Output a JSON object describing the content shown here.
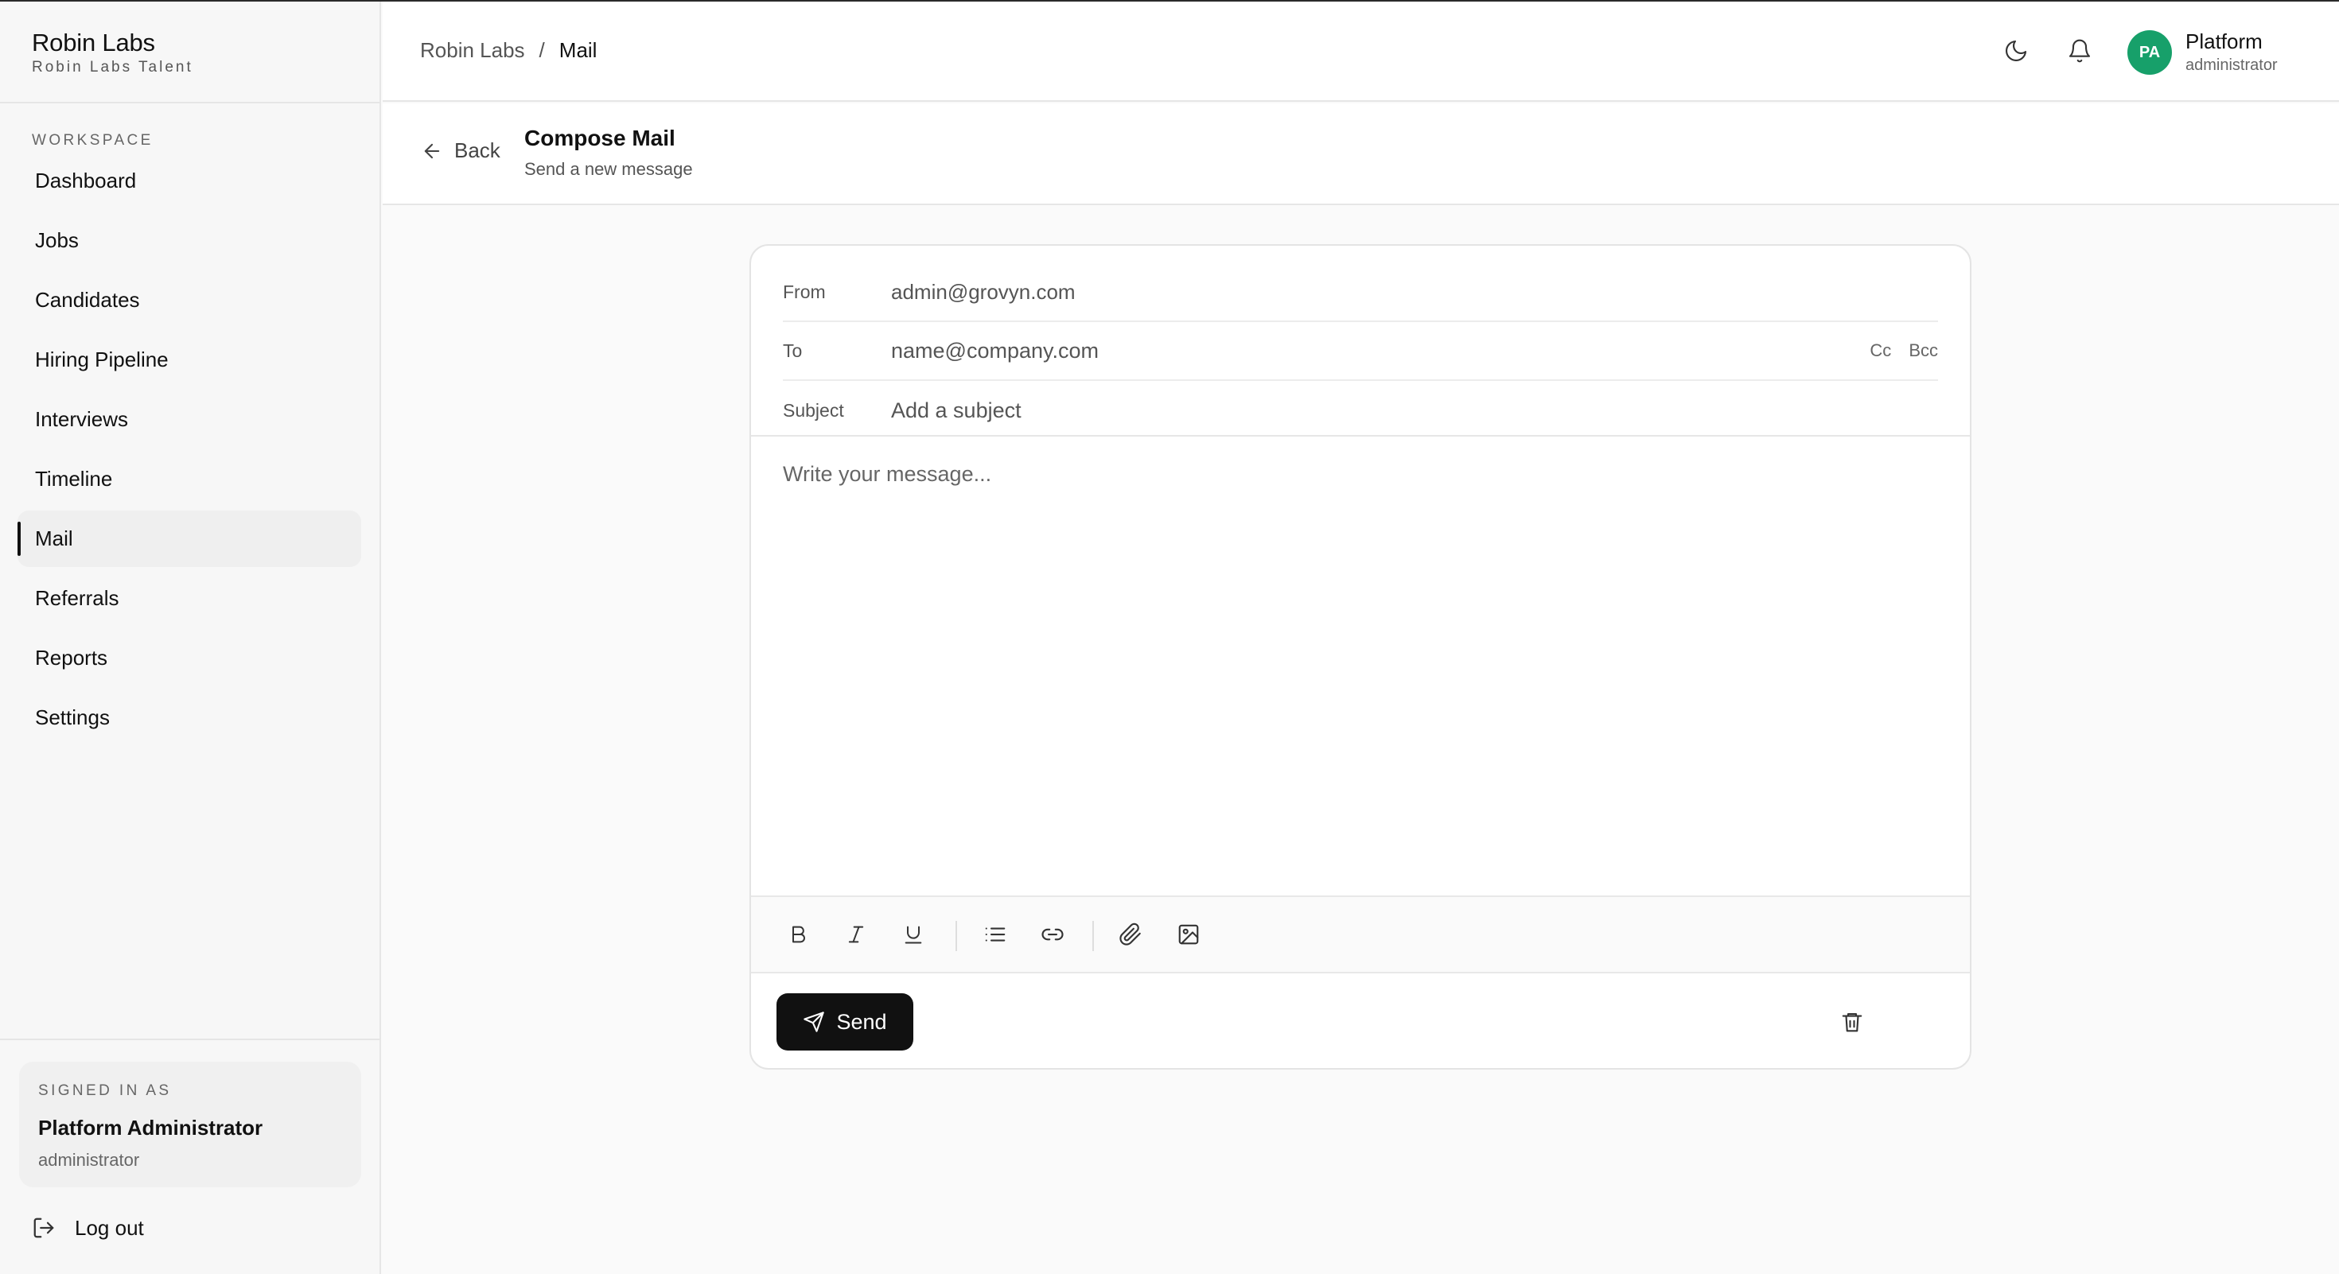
{
  "brand": {
    "name": "Robin Labs",
    "subtitle": "Robin Labs Talent"
  },
  "sidebar": {
    "section_label": "WORKSPACE",
    "items": [
      {
        "label": "Dashboard",
        "active": false
      },
      {
        "label": "Jobs",
        "active": false
      },
      {
        "label": "Candidates",
        "active": false
      },
      {
        "label": "Hiring Pipeline",
        "active": false
      },
      {
        "label": "Interviews",
        "active": false
      },
      {
        "label": "Timeline",
        "active": false
      },
      {
        "label": "Mail",
        "active": true
      },
      {
        "label": "Referrals",
        "active": false
      },
      {
        "label": "Reports",
        "active": false
      },
      {
        "label": "Settings",
        "active": false
      }
    ],
    "signed_in": {
      "label": "SIGNED IN AS",
      "name": "Platform Administrator",
      "role": "administrator"
    },
    "logout_label": "Log out"
  },
  "topbar": {
    "breadcrumb": {
      "root": "Robin Labs",
      "separator": "/",
      "current": "Mail"
    },
    "icons": [
      "moon-icon",
      "bell-icon"
    ],
    "user": {
      "initials": "PA",
      "name": "Platform",
      "role": "administrator",
      "avatar_color": "#17a06a"
    }
  },
  "page": {
    "back_label": "Back",
    "title": "Compose Mail",
    "subtitle": "Send a new message"
  },
  "compose": {
    "from": {
      "label": "From",
      "value": "admin@grovyn.com"
    },
    "to": {
      "label": "To",
      "placeholder": "name@company.com",
      "cc_label": "Cc",
      "bcc_label": "Bcc"
    },
    "subject": {
      "label": "Subject",
      "placeholder": "Add a subject"
    },
    "message_placeholder": "Write your message...",
    "toolbar_icons": [
      "bold-icon",
      "italic-icon",
      "underline-icon",
      "list-icon",
      "link-icon",
      "paperclip-icon",
      "image-icon"
    ],
    "send_label": "Send",
    "send_color": "#111111"
  }
}
